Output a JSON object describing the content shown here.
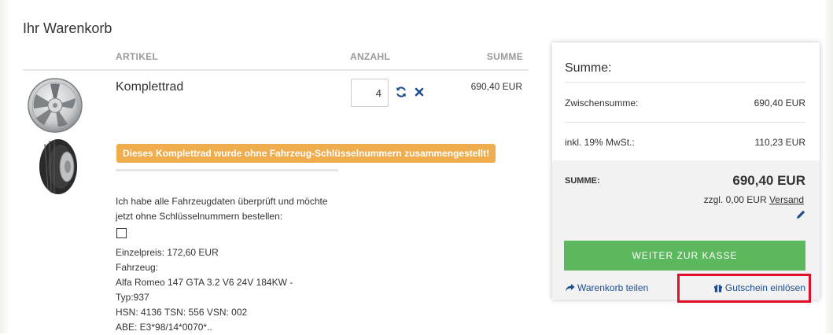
{
  "cart": {
    "title": "Ihr Warenkorb",
    "columns": {
      "article": "ARTIKEL",
      "quantity": "ANZAHL",
      "total": "SUMME"
    }
  },
  "item": {
    "name": "Komplettrad",
    "quantity": "4",
    "line_total": "690,40 EUR",
    "warning": "Dieses Komplettrad wurde ohne Fahrzeug-Schlüsselnummern zusammengestellt!",
    "confirm_text": "Ich habe alle Fahrzeugdaten überprüft und möchte jetzt ohne Schlüsselnummern bestellen:",
    "details": [
      "Einzelpreis: 172,60 EUR",
      "Fahrzeug:",
      "Alfa Romeo 147 GTA 3.2 V6 24V 184KW -",
      "Typ:937",
      "HSN: 4136 TSN: 556 VSN: 002",
      "ABE: E3*98/14*0070*.."
    ]
  },
  "summary": {
    "heading": "Summe:",
    "subtotal_label": "Zwischensumme:",
    "subtotal_value": "690,40 EUR",
    "tax_label": "inkl. 19% MwSt.:",
    "tax_value": "110,23 EUR",
    "total_label": "SUMME:",
    "total_value": "690,40 EUR",
    "shipping_prefix": "zzgl. 0,00 EUR ",
    "shipping_link": "Versand",
    "checkout_label": "WEITER ZUR KASSE",
    "share_label": "Warenkorb teilen",
    "voucher_label": "Gutschein einlösen"
  },
  "icons": {
    "refresh": "refresh-icon",
    "remove": "close-icon",
    "edit": "pencil-icon",
    "share": "share-icon",
    "voucher": "gift-icon"
  },
  "colors": {
    "accent_blue": "#1e4d8c",
    "checkout_green": "#5cb85c",
    "warning_orange": "#f0ad4e",
    "highlight_red": "#e0102a"
  }
}
